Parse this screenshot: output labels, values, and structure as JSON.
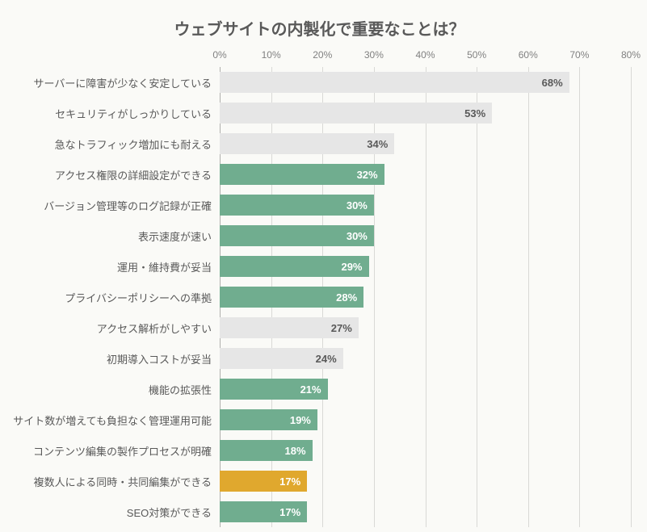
{
  "chart_data": {
    "type": "bar",
    "orientation": "horizontal",
    "title": "ウェブサイトの内製化で重要なことは？",
    "xlabel": "",
    "ylabel": "",
    "unit": "%",
    "xlim": [
      0,
      80
    ],
    "ticks": [
      0,
      10,
      20,
      30,
      40,
      50,
      60,
      70,
      80
    ],
    "tick_labels": [
      "0%",
      "10%",
      "20%",
      "30%",
      "40%",
      "50%",
      "60%",
      "70%",
      "80%"
    ],
    "categories": [
      "サーバーに障害が少なく安定している",
      "セキュリティがしっかりしている",
      "急なトラフィック増加にも耐える",
      "アクセス権限の詳細設定ができる",
      "バージョン管理等のログ記録が正確",
      "表示速度が速い",
      "運用・維持費が妥当",
      "プライバシーポリシーへの準拠",
      "アクセス解析がしやすい",
      "初期導入コストが妥当",
      "機能の拡張性",
      "サイト数が増えても負担なく管理運用可能",
      "コンテンツ編集の製作プロセスが明確",
      "複数人による同時・共同編集ができる",
      "SEO対策ができる"
    ],
    "values": [
      68,
      53,
      34,
      32,
      30,
      30,
      29,
      28,
      27,
      24,
      21,
      19,
      18,
      17,
      17
    ],
    "value_labels": [
      "68%",
      "53%",
      "34%",
      "32%",
      "30%",
      "30%",
      "29%",
      "28%",
      "27%",
      "24%",
      "21%",
      "19%",
      "18%",
      "17%",
      "17%"
    ],
    "colors": [
      "grey",
      "grey",
      "grey",
      "green",
      "green",
      "green",
      "green",
      "green",
      "grey",
      "grey",
      "green",
      "green",
      "green",
      "gold",
      "green"
    ],
    "color_map": {
      "green": "#70ad8f",
      "grey": "#e6e6e6",
      "gold": "#e0a82e"
    }
  }
}
